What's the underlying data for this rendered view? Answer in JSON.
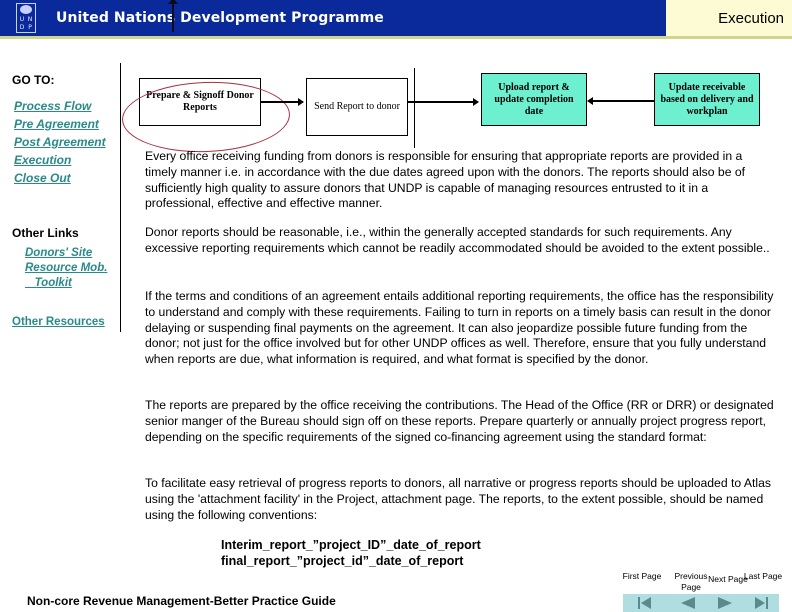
{
  "header": {
    "org_name": "United Nations Development Programme",
    "logo_cells": [
      "U",
      "N",
      "D",
      "P"
    ],
    "section_title": "Execution"
  },
  "left_nav": {
    "goto_title": "GO TO:",
    "goto_links": [
      "Process Flow",
      "Pre Agreement",
      "Post Agreement",
      "Execution",
      "Close Out"
    ],
    "other_links_title": "Other Links",
    "other_links": [
      "Donors' Site",
      "Resource Mob.",
      "   Toolkit"
    ],
    "other_resources": "Other Resources"
  },
  "flow": {
    "steps": [
      {
        "label": "Prepare & Signoff Donor Reports",
        "highlighted": true
      },
      {
        "label": "Send Report to donor"
      },
      {
        "label": "Upload report & update completion date"
      },
      {
        "label": "Update receivable based on delivery and workplan"
      }
    ],
    "colors": {
      "teal_box": "#6cf0cf",
      "highlight_ellipse": "#a83240"
    }
  },
  "content": {
    "paragraphs": [
      "Every office receiving funding from donors is responsible for ensuring that appropriate reports are provided in a timely manner i.e. in accordance with the due dates agreed upon with the donors. The reports should also be of sufficiently high quality to assure donors that UNDP is capable of managing resources entrusted to it in a professional, effective and effective manner.",
      "Donor reports should be reasonable, i.e., within the generally accepted standards for such requirements. Any excessive reporting requirements which cannot be readily accommodated should be avoided to the extent possible..",
      "If  the terms and conditions of an agreement entails additional reporting requirements, the office has the responsibility to understand and comply with these requirements. Failing to turn in reports on a timely basis can result in the donor  delaying or suspending final payments on the agreement.  It can also jeopardize possible future funding from the donor; not just for the office involved but for other UNDP offices as well. Therefore, ensure that you fully understand when reports are due, what information is required, and what format is specified by the donor.",
      "The reports are prepared by the office receiving the contributions. The Head of the Office (RR or DRR) or designated senior manger of the Bureau should sign off on these reports.   Prepare quarterly or annually project progress report, depending on the specific requirements of the signed co-financing agreement using the standard format:",
      "To facilitate easy retrieval of progress reports to  donors, all  narrative or progress reports should be uploaded to Atlas using the 'attachment facility' in the Project, attachment page. The reports, to the extent possible, should be named using the following conventions:"
    ],
    "conventions": [
      "Interim_report_”project_ID”_date_of_report",
      "final_report_”project_id”_date_of_report"
    ]
  },
  "footer": {
    "title": "Non-core Revenue Management-Better Practice Guide",
    "nav": [
      {
        "label": "First Page",
        "icon": "first-page-icon"
      },
      {
        "label": "Previous Page",
        "icon": "previous-page-icon"
      },
      {
        "label": "Next Page",
        "icon": "next-page-icon"
      },
      {
        "label": "Last Page",
        "icon": "last-page-icon"
      }
    ]
  }
}
